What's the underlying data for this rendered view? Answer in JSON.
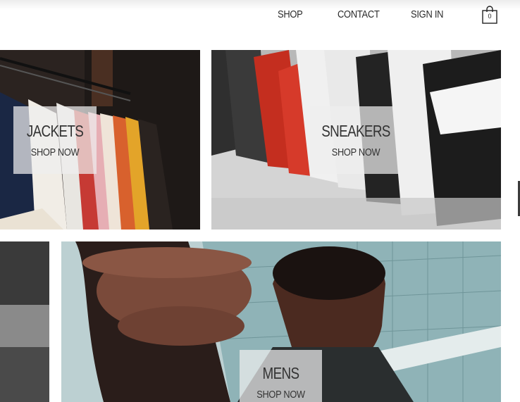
{
  "header": {
    "nav": [
      {
        "label": "SHOP"
      },
      {
        "label": "CONTACT"
      },
      {
        "label": "SIGN IN"
      }
    ],
    "cart": {
      "icon": "shopping-bag-icon",
      "count": "0"
    }
  },
  "tiles": [
    {
      "title": "JACKETS",
      "cta": "SHOP NOW"
    },
    {
      "title": "SNEAKERS",
      "cta": "SHOP NOW"
    },
    {
      "title": "MENS",
      "cta": "SHOP NOW"
    }
  ]
}
